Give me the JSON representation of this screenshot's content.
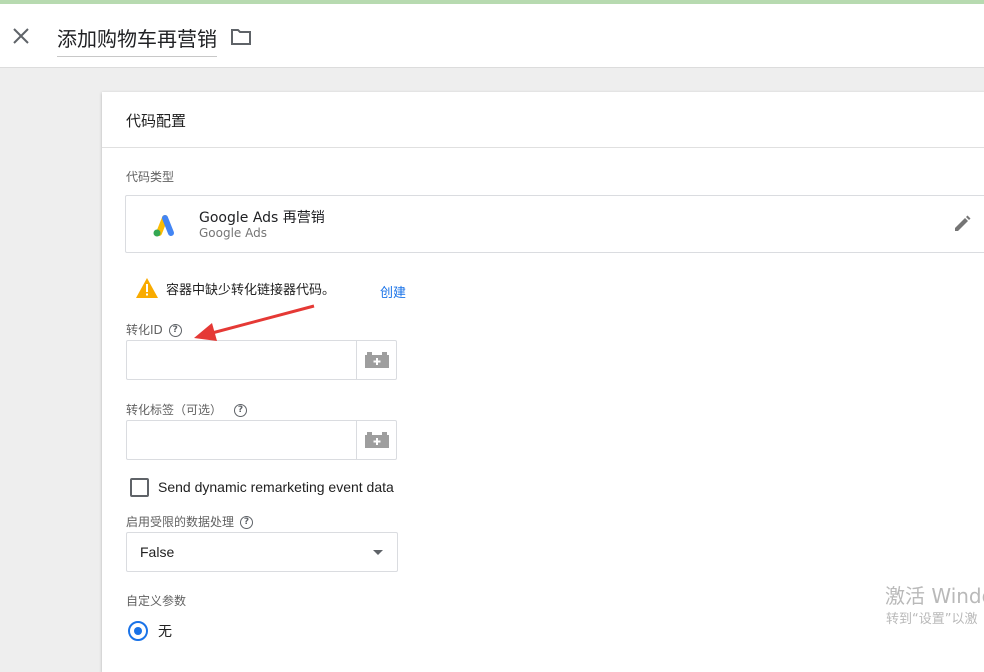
{
  "header": {
    "title": "添加购物车再营销",
    "close_icon": "close-icon",
    "folder_icon": "folder-icon"
  },
  "card": {
    "title": "代码配置",
    "tag_type_label": "代码类型",
    "tag_type": {
      "name": "Google Ads 再营销",
      "subtitle": "Google Ads",
      "logo_icon": "google-ads-logo",
      "edit_icon": "pencil-icon"
    },
    "warning": {
      "text": "容器中缺少转化链接器代码。",
      "link": "创建",
      "color": "#f9ab00"
    },
    "conversion_id": {
      "label": "转化ID",
      "value": ""
    },
    "conversion_label": {
      "label": "转化标签（可选）",
      "value": ""
    },
    "checkbox": {
      "label": "Send dynamic remarketing event data",
      "checked": false
    },
    "restricted": {
      "label": "启用受限的数据处理",
      "value": "False"
    },
    "custom_params": {
      "label": "自定义参数",
      "option_label": "无",
      "selected": true
    }
  },
  "watermark": {
    "line1": "激活 Windo",
    "line2": "转到“设置”以激"
  },
  "colors": {
    "accent": "#1a73e8",
    "annotation_arrow": "#e53935"
  }
}
